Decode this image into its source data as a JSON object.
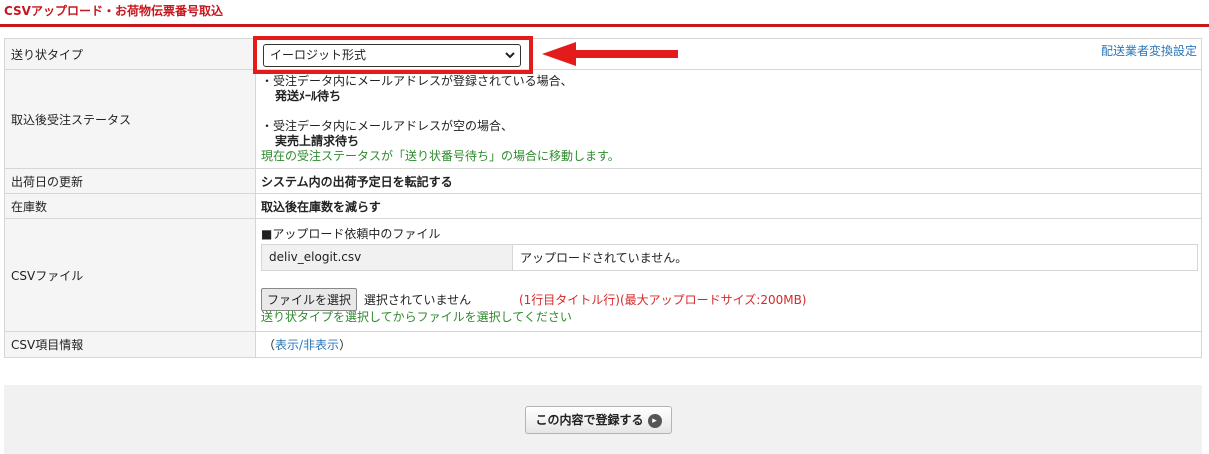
{
  "page_title": "CSVアップロード・お荷物伝票番号取込",
  "colors": {
    "accent": "#c8161d",
    "link": "#2b76b9",
    "green": "#2e8b2e",
    "red": "#d42a2a"
  },
  "rows": {
    "type": {
      "label": "送り状タイプ",
      "selected": "イーロジット形式",
      "vendor_link": "配送業者変換設定"
    },
    "status": {
      "label": "取込後受注ステータス",
      "line1": "・受注データ内にメールアドレスが登録されている場合、",
      "line1_value": "発送ﾒｰﾙ待ち",
      "line2": "・受注データ内にメールアドレスが空の場合、",
      "line2_value": "実売上請求待ち",
      "note": "現在の受注ステータスが「送り状番号待ち」の場合に移動します。"
    },
    "ship": {
      "label": "出荷日の更新",
      "value": "システム内の出荷予定日を転記する"
    },
    "stock": {
      "label": "在庫数",
      "value": "取込後在庫数を減らす"
    },
    "csv": {
      "label": "CSVファイル",
      "heading": "■アップロード依頼中のファイル",
      "file_name": "deliv_elogit.csv",
      "file_status": "アップロードされていません。",
      "choose_button": "ファイルを選択",
      "no_file": "選択されていません",
      "limit_note": "(1行目タイトル行)(最大アップロードサイズ:200MB)",
      "hint": "送り状タイプを選択してからファイルを選択してください"
    },
    "info": {
      "label": "CSV項目情報",
      "open_paren": "（",
      "toggle": "表示/非表示",
      "close_paren": "）"
    }
  },
  "submit_label": "この内容で登録する"
}
